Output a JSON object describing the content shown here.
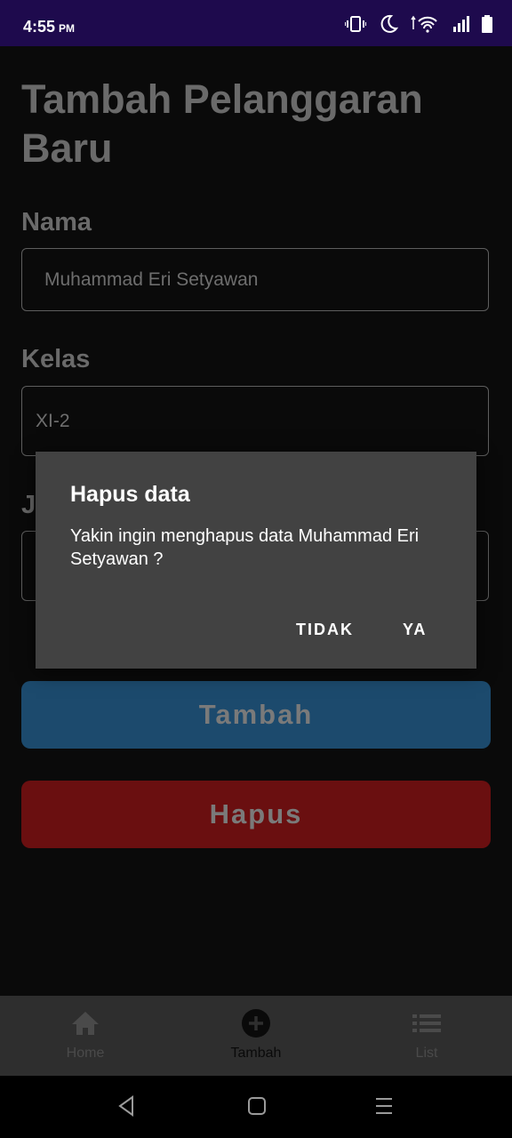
{
  "status": {
    "time": "4:55",
    "ampm": "PM"
  },
  "page": {
    "title": "Tambah Pelanggaran Baru",
    "nama_label": "Nama",
    "nama_value": "Muhammad Eri Setyawan",
    "kelas_label": "Kelas",
    "kelas_value": "XI-2",
    "third_label_partial": "J",
    "tambah_button": "Tambah",
    "hapus_button": "Hapus"
  },
  "dialog": {
    "title": "Hapus data",
    "message": "Yakin ingin menghapus data Muhammad Eri Setyawan ?",
    "cancel": "TIDAK",
    "confirm": "YA"
  },
  "nav": {
    "items": [
      {
        "label": "Home",
        "icon": "home-icon"
      },
      {
        "label": "Tambah",
        "icon": "add-circle-icon"
      },
      {
        "label": "List",
        "icon": "list-icon"
      }
    ]
  },
  "colors": {
    "statusbar": "#1e0a4d",
    "tambah": "#1c4a6d",
    "hapus": "#6a0f10",
    "dialog": "#424242"
  }
}
